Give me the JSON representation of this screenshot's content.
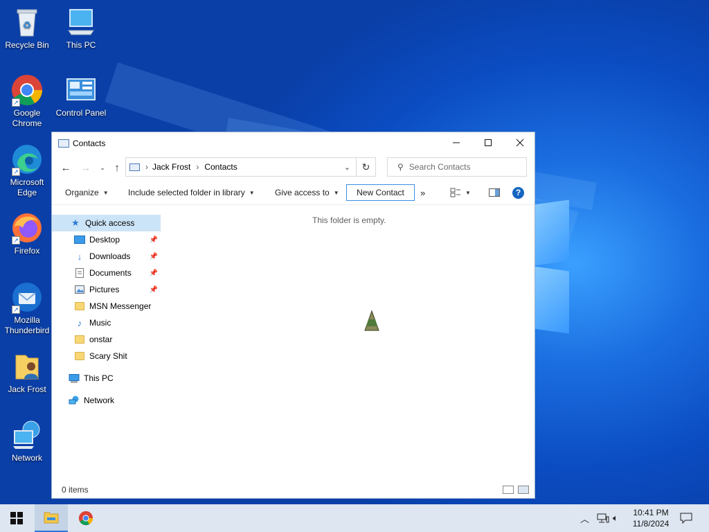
{
  "desktop": {
    "icons": [
      {
        "label": "Recycle Bin"
      },
      {
        "label": "This PC"
      },
      {
        "label": "Google Chrome"
      },
      {
        "label": "Control Panel"
      },
      {
        "label": "Microsoft Edge"
      },
      {
        "label": "Firefox"
      },
      {
        "label": "Mozilla Thunderbird"
      },
      {
        "label": "Jack Frost"
      },
      {
        "label": "Network"
      }
    ]
  },
  "window": {
    "title": "Contacts",
    "breadcrumb": [
      "Jack Frost",
      "Contacts"
    ],
    "search_placeholder": "Search Contacts",
    "commands": {
      "organize": "Organize",
      "include": "Include selected folder in library",
      "give_access": "Give access to",
      "new_contact": "New Contact",
      "more": "»"
    },
    "nav": {
      "quick_access": "Quick access",
      "pinned": [
        {
          "label": "Desktop"
        },
        {
          "label": "Downloads"
        },
        {
          "label": "Documents"
        },
        {
          "label": "Pictures"
        }
      ],
      "recent": [
        {
          "label": "MSN Messenger"
        },
        {
          "label": "Music"
        },
        {
          "label": "onstar"
        },
        {
          "label": "Scary Shit"
        }
      ],
      "this_pc": "This PC",
      "network": "Network"
    },
    "empty_message": "This folder is empty.",
    "status": "0 items"
  },
  "taskbar": {
    "time": "10:41 PM",
    "date": "11/8/2024"
  },
  "colors": {
    "accent": "#0078d7",
    "selection": "#cce4f7",
    "taskbar": "#dde6f1"
  }
}
